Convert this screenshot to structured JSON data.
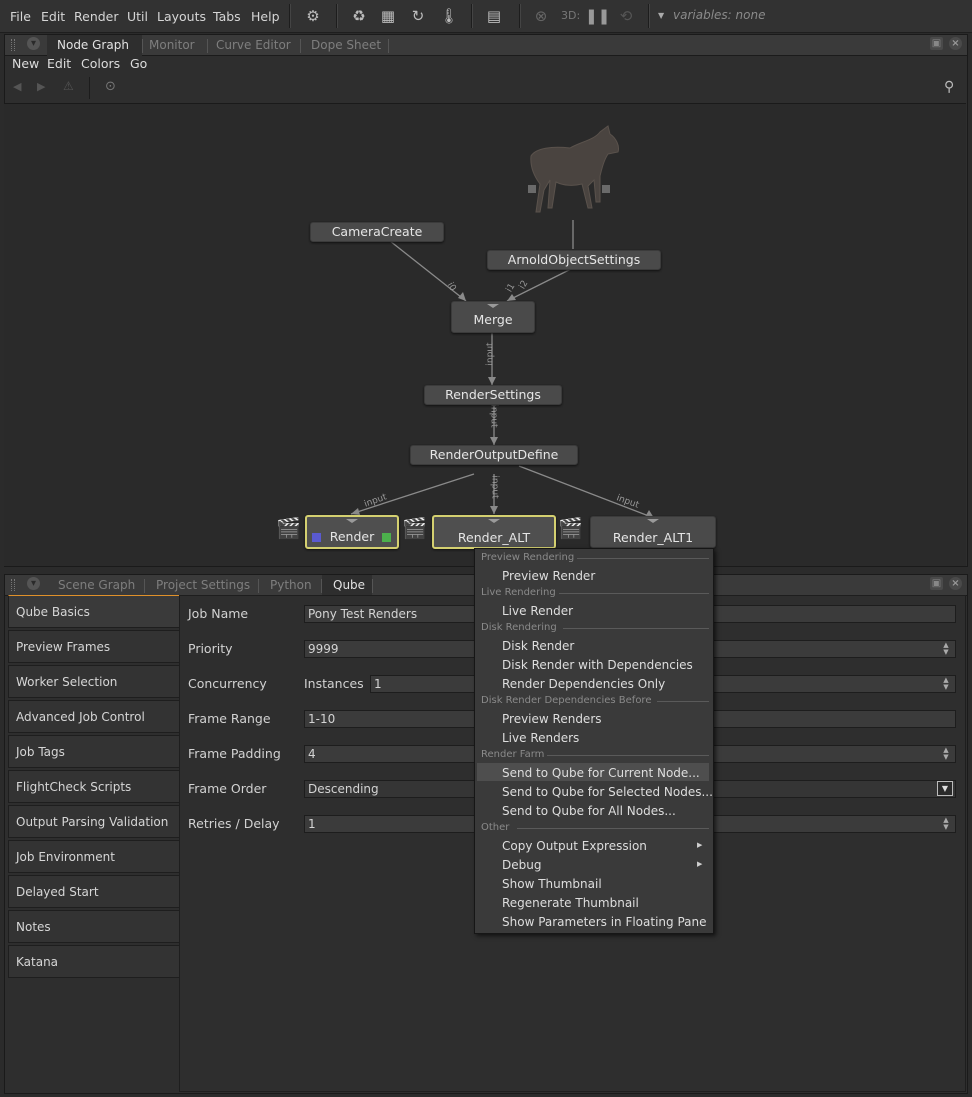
{
  "menubar": {
    "items": [
      "File",
      "Edit",
      "Render",
      "Util",
      "Layouts",
      "Tabs",
      "Help"
    ],
    "label_3d": "3D:",
    "variables": "variables: none"
  },
  "node_graph_panel": {
    "tabs": [
      "Node Graph",
      "Monitor",
      "Curve Editor",
      "Dope Sheet"
    ],
    "menu": [
      "New",
      "Edit",
      "Colors",
      "Go"
    ]
  },
  "graph": {
    "nodes": {
      "camera": "CameraCreate",
      "arnold": "ArnoldObjectSettings",
      "merge": "Merge",
      "render_settings": "RenderSettings",
      "output_define": "RenderOutputDefine",
      "render": "Render",
      "render_alt": "Render_ALT",
      "render_alt1": "Render_ALT1"
    },
    "ports": {
      "i0": "i0",
      "i1": "i1",
      "i2": "i2",
      "input_a": "input",
      "input_b": "input",
      "input_c": "input",
      "input_d": "input",
      "input_e": "input"
    }
  },
  "params_panel": {
    "tabs": [
      "Scene Graph",
      "Project Settings",
      "Python",
      "Qube"
    ],
    "sidebar": [
      "Qube Basics",
      "Preview Frames",
      "Worker Selection",
      "Advanced Job Control",
      "Job Tags",
      "FlightCheck Scripts",
      "Output Parsing Validation",
      "Job Environment",
      "Delayed Start",
      "Notes",
      "Katana"
    ],
    "fields": {
      "job_name": {
        "label": "Job Name",
        "value": "Pony Test Renders"
      },
      "priority": {
        "label": "Priority",
        "value": "9999"
      },
      "concurrency": {
        "label": "Concurrency",
        "sub_label": "Instances",
        "value": "1"
      },
      "frame_range": {
        "label": "Frame Range",
        "value": "1-10"
      },
      "frame_padding": {
        "label": "Frame Padding",
        "value": "4"
      },
      "frame_order": {
        "label": "Frame Order",
        "value": "Descending"
      },
      "retries": {
        "label": "Retries / Delay",
        "value": "1"
      }
    }
  },
  "context_menu": {
    "sections": {
      "preview": "Preview Rendering",
      "live": "Live Rendering",
      "disk": "Disk Rendering",
      "deps_before": "Disk Render Dependencies Before",
      "farm": "Render Farm",
      "other": "Other"
    },
    "items": {
      "preview_render": "Preview Render",
      "live_render": "Live Render",
      "disk_render": "Disk Render",
      "disk_render_deps": "Disk Render with Dependencies",
      "render_deps_only": "Render Dependencies Only",
      "preview_renders": "Preview Renders",
      "live_renders": "Live Renders",
      "send_current": "Send to Qube for Current Node...",
      "send_selected": "Send to Qube for Selected Nodes...",
      "send_all": "Send to Qube for All Nodes...",
      "copy_output": "Copy Output Expression",
      "debug": "Debug",
      "show_thumb": "Show Thumbnail",
      "regen_thumb": "Regenerate Thumbnail",
      "show_params": "Show Parameters in Floating Pane"
    }
  }
}
